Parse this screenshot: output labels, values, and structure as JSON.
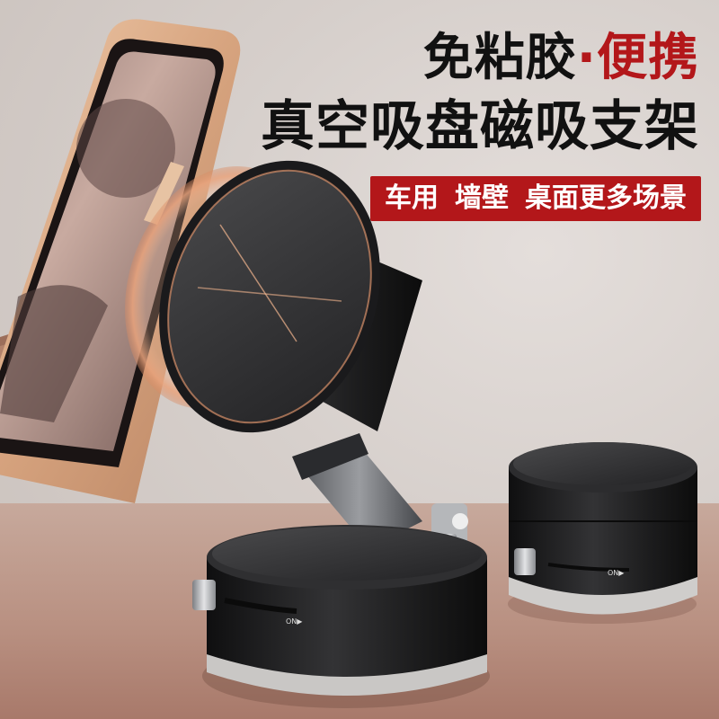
{
  "headline": {
    "line1_part1": "免粘胶",
    "separator": "·",
    "line1_part2": "便携",
    "line2": "真空吸盘磁吸支架"
  },
  "tags": [
    "车用",
    "墙壁",
    "桌面更多场景"
  ],
  "device_label": "ON▶",
  "colors": {
    "accent": "#b3171a",
    "text": "#111111",
    "device": "#1e1e1e"
  }
}
